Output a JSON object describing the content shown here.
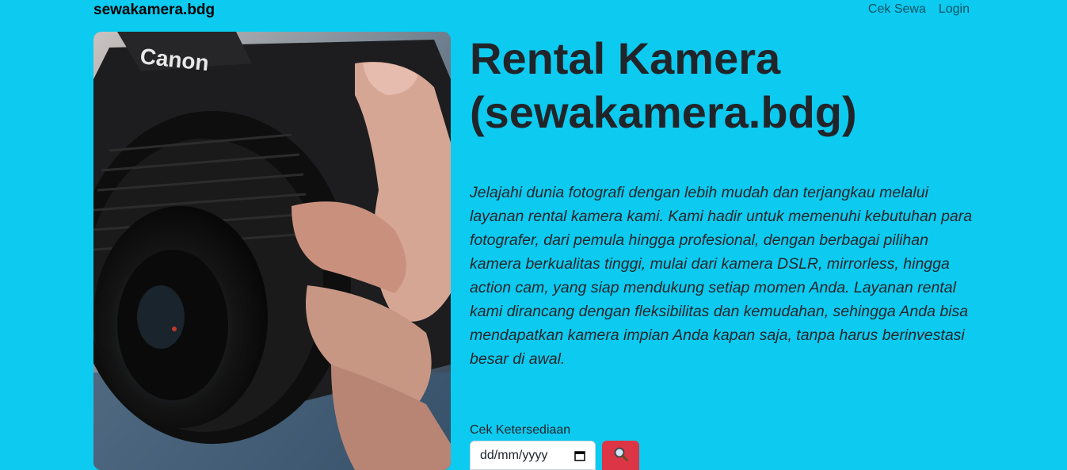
{
  "navbar": {
    "brand": "sewakamera.bdg",
    "links": [
      "Cek Sewa",
      "Login"
    ]
  },
  "hero": {
    "image_alt": "Camera",
    "title": "Rental Kamera (sewakamera.bdg)",
    "description": "Jelajahi dunia fotografi dengan lebih mudah dan terjangkau melalui layanan rental kamera kami. Kami hadir untuk memenuhi kebutuhan para fotografer, dari pemula hingga profesional, dengan berbagai pilihan kamera berkualitas tinggi, mulai dari kamera DSLR, mirrorless, hingga action cam, yang siap mendukung setiap momen Anda. Layanan rental kami dirancang dengan fleksibilitas dan kemudahan, sehingga Anda bisa mendapatkan kamera impian Anda kapan saja, tanpa harus berinvestasi besar di awal."
  },
  "availability": {
    "label": "Cek Ketersediaan",
    "date_placeholder": "dd/mm/yyyy",
    "search_icon": "magnifier-icon"
  },
  "colors": {
    "background": "#0dcaf0",
    "button": "#dc3545"
  },
  "photo_text": {
    "camera_brand": "Canon"
  }
}
